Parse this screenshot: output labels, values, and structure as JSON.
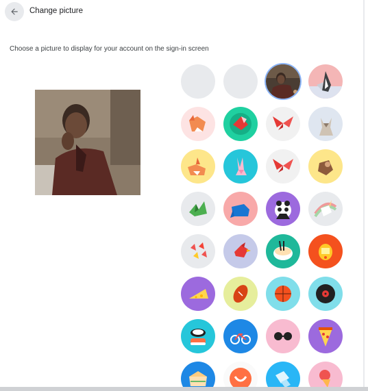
{
  "header": {
    "title": "Change picture",
    "back_icon": "arrow-left-icon"
  },
  "main": {
    "subtitle": "Choose a picture to display for your account on the sign-in screen"
  },
  "preview": {
    "alt": "Current account picture preview"
  },
  "avatar_options": [
    {
      "name": "camera",
      "icon": "camera-icon",
      "selected": false
    },
    {
      "name": "folder",
      "icon": "folder-icon",
      "selected": false
    },
    {
      "name": "profile-photo",
      "icon": "profile-photo",
      "selected": true
    },
    {
      "name": "origami-penguin",
      "icon": "penguin",
      "selected": false
    },
    {
      "name": "origami-fox",
      "icon": "fox",
      "selected": false
    },
    {
      "name": "origami-bird-green",
      "icon": "bird",
      "selected": false
    },
    {
      "name": "origami-butterfly-red",
      "icon": "butterfly",
      "selected": false
    },
    {
      "name": "origami-cat",
      "icon": "cat",
      "selected": false
    },
    {
      "name": "origami-corgi",
      "icon": "dog",
      "selected": false
    },
    {
      "name": "origami-rabbit",
      "icon": "rabbit",
      "selected": false
    },
    {
      "name": "origami-butterfly-blue",
      "icon": "butterfly",
      "selected": false
    },
    {
      "name": "origami-monkey",
      "icon": "monkey",
      "selected": false
    },
    {
      "name": "origami-dragon",
      "icon": "dragon",
      "selected": false
    },
    {
      "name": "origami-elephant",
      "icon": "elephant",
      "selected": false
    },
    {
      "name": "origami-panda",
      "icon": "panda",
      "selected": false
    },
    {
      "name": "origami-unicorn",
      "icon": "unicorn",
      "selected": false
    },
    {
      "name": "origami-cranes",
      "icon": "cranes",
      "selected": false
    },
    {
      "name": "origami-cardinal",
      "icon": "cardinal",
      "selected": false
    },
    {
      "name": "ramen-bowl",
      "icon": "ramen",
      "selected": false
    },
    {
      "name": "tamagotchi",
      "icon": "tamagotchi",
      "selected": false
    },
    {
      "name": "cheese",
      "icon": "cheese",
      "selected": false
    },
    {
      "name": "football",
      "icon": "football",
      "selected": false
    },
    {
      "name": "basketball",
      "icon": "basketball",
      "selected": false
    },
    {
      "name": "vinyl-record",
      "icon": "vinyl",
      "selected": false
    },
    {
      "name": "sushi",
      "icon": "sushi",
      "selected": false
    },
    {
      "name": "bicycle",
      "icon": "bicycle",
      "selected": false
    },
    {
      "name": "sunglasses",
      "icon": "sunglasses",
      "selected": false
    },
    {
      "name": "pizza",
      "icon": "pizza",
      "selected": false
    },
    {
      "name": "sandwich",
      "icon": "sandwich",
      "selected": false
    },
    {
      "name": "smile-face",
      "icon": "smile",
      "selected": false
    },
    {
      "name": "ice-cube",
      "icon": "ice",
      "selected": false
    },
    {
      "name": "ice-cream",
      "icon": "icecream",
      "selected": false
    }
  ]
}
